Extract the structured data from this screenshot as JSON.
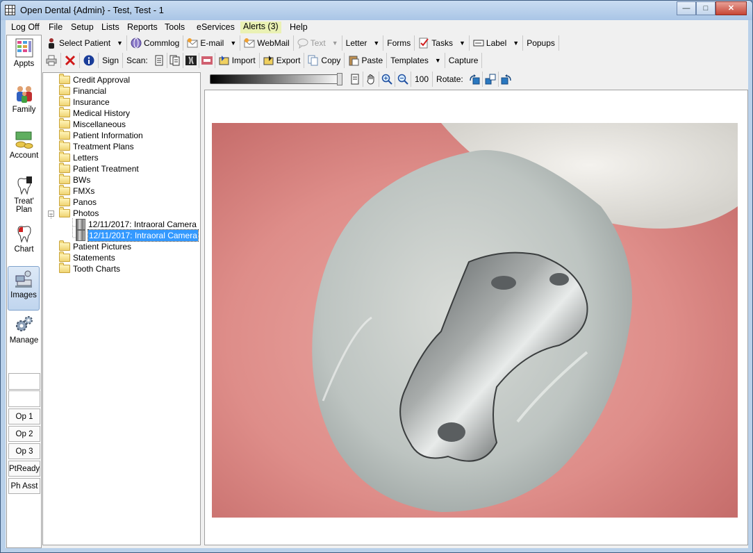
{
  "window": {
    "title": "Open Dental {Admin} - Test, Test - 1",
    "controls": {
      "minimize": "—",
      "maximize": "□",
      "close": "✕"
    }
  },
  "menu": [
    "Log Off",
    "File",
    "Setup",
    "Lists",
    "Reports",
    "Tools",
    "eServices",
    "Alerts (3)",
    "Help"
  ],
  "modules": {
    "appts": "Appts",
    "family": "Family",
    "account": "Account",
    "treat_plan": "Treat' Plan",
    "chart": "Chart",
    "images": "Images",
    "manage": "Manage"
  },
  "operatories": [
    "Op 1",
    "Op 2",
    "Op 3",
    "PtReady",
    "Ph Asst"
  ],
  "main_toolbar": {
    "select_patient": "Select Patient",
    "commlog": "Commlog",
    "email": "E-mail",
    "webmail": "WebMail",
    "text": "Text",
    "letter": "Letter",
    "forms": "Forms",
    "tasks": "Tasks",
    "label": "Label",
    "popups": "Popups"
  },
  "image_toolbar": {
    "sign": "Sign",
    "scan": "Scan:",
    "import": "Import",
    "export": "Export",
    "copy": "Copy",
    "paste": "Paste",
    "templates": "Templates",
    "capture": "Capture"
  },
  "view_toolbar": {
    "zoom_value": "100",
    "rotate": "Rotate:"
  },
  "tree": {
    "folders_before": [
      "Credit Approval",
      "Financial",
      "Insurance",
      "Medical History",
      "Miscellaneous",
      "Patient Information",
      "Treatment Plans",
      "Letters",
      "Patient Treatment",
      "BWs",
      "FMXs",
      "Panos"
    ],
    "photos_folder": "Photos",
    "photo_docs": [
      "12/11/2017: Intraoral Camera",
      "12/11/2017: Intraoral Camera"
    ],
    "selected_doc_index": 1,
    "folders_after": [
      "Patient Pictures",
      "Statements",
      "Tooth Charts"
    ],
    "expander": "−"
  },
  "colors": {
    "selection": "#3399ff",
    "alerts_bg": "#eaf1b4",
    "title_gradient": "#a9c5e6"
  }
}
